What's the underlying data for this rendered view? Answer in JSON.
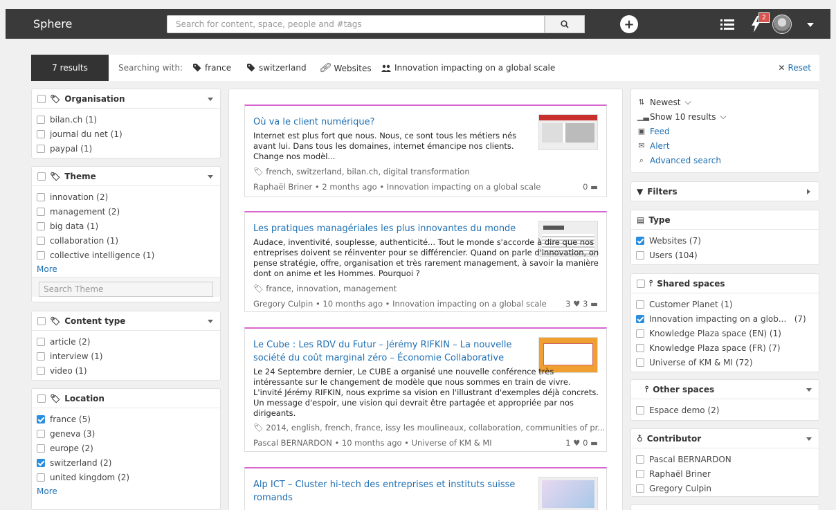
{
  "topbar": {
    "brand": "Sphere",
    "search_placeholder": "Search for content, space, people and #tags",
    "notification_count": "2"
  },
  "results_bar": {
    "count_label": "7 results",
    "searching_label": "Searching with:",
    "tags": [
      {
        "label": "france",
        "icon": "tag-icon"
      },
      {
        "label": "switzerland",
        "icon": "tag-icon"
      },
      {
        "label": "Websites",
        "icon": "link-icon"
      },
      {
        "label": "Innovation impacting on a global scale",
        "icon": "group-icon"
      }
    ],
    "reset_label": "Reset"
  },
  "left_facets": {
    "organisation": {
      "title": "Organisation",
      "items": [
        {
          "label": "bilan.ch (1)",
          "checked": false
        },
        {
          "label": "journal du net (1)",
          "checked": false
        },
        {
          "label": "paypal (1)",
          "checked": false
        }
      ]
    },
    "theme": {
      "title": "Theme",
      "items": [
        {
          "label": "innovation (2)",
          "checked": false
        },
        {
          "label": "management (2)",
          "checked": false
        },
        {
          "label": "big data (1)",
          "checked": false
        },
        {
          "label": "collaboration (1)",
          "checked": false
        },
        {
          "label": "collective intelligence (1)",
          "checked": false
        }
      ],
      "more": "More",
      "search_placeholder": "Search Theme"
    },
    "content_type": {
      "title": "Content type",
      "items": [
        {
          "label": "article (2)",
          "checked": false
        },
        {
          "label": "interview (1)",
          "checked": false
        },
        {
          "label": "video (1)",
          "checked": false
        }
      ]
    },
    "location": {
      "title": "Location",
      "items": [
        {
          "label": "france (5)",
          "checked": true
        },
        {
          "label": "geneva (3)",
          "checked": false
        },
        {
          "label": "europe (2)",
          "checked": false
        },
        {
          "label": "switzerland (2)",
          "checked": true
        },
        {
          "label": "united kingdom (2)",
          "checked": false
        }
      ],
      "more": "More"
    }
  },
  "results": [
    {
      "title": "Où va le client numérique?",
      "description": "Internet est plus fort que nous. Nous, ce sont tous les métiers nés avant lui. Dans tous les domaines, internet émancipe nos clients. Change nos modèl...",
      "tags": "french, switzerland, bilan.ch, digital transformation",
      "meta": "Raphaël Briner • 2 months ago • Innovation impacting on a global scale",
      "counts": "0"
    },
    {
      "title": "Les pratiques managériales les plus innovantes du monde",
      "description": "Audace, inventivité, souplesse, authenticité... Tout le monde s'accorde à dire que nos entreprises doivent se réinventer pour se différencier. Quand on parle d'innovation, on pense stratégie, offre, organisation et très rarement management, à savoir la manière dont on anime et les Hommes. Pourquoi ?",
      "tags": "france, innovation, management",
      "meta": "Gregory Culpin • 10 months ago • Innovation impacting on a global scale",
      "counts": "3 ♥ 3"
    },
    {
      "title": "Le Cube : Les RDV du Futur – Jérémy RIFKIN – La nouvelle société du coût marginal zéro – Économie Collaborative",
      "description": "Le 24 Septembre dernier, Le CUBE a organisé une nouvelle conférence très intéressante sur le changement de modèle que nous sommes en train de vivre. L'invité Jérémy RIFKIN, nous exprime sa vision en l'illustrant d'exemples déjà concrets. Un message d'espoir, une vision qui devrait être partagée et appropriée par nos dirigeants.",
      "tags": "2014, english, french, france, issy les moulineaux, collaboration, communities of pr...",
      "meta": "Pascal BERNARDON • 10 months ago • Universe of KM & MI",
      "counts": "1 ♥ 0"
    },
    {
      "title": "Alp ICT – Cluster hi-tech des entreprises et instituts suisse romands",
      "description": "",
      "tags": "",
      "meta": "",
      "counts": ""
    }
  ],
  "right_panel": {
    "sort_label": "Newest",
    "show_label": "Show 10 results",
    "feed_label": "Feed",
    "alert_label": "Alert",
    "advanced_label": "Advanced search",
    "filters_title": "Filters",
    "type": {
      "title": "Type",
      "items": [
        {
          "label": "Websites (7)",
          "checked": true
        },
        {
          "label": "Users (104)",
          "checked": false
        }
      ]
    },
    "shared_spaces": {
      "title": "Shared spaces",
      "items": [
        {
          "label": "Customer Planet (1)",
          "checked": false
        },
        {
          "label": "Innovation impacting on a glob...   (7)",
          "checked": true
        },
        {
          "label": "Knowledge Plaza space (EN) (1)",
          "checked": false
        },
        {
          "label": "Knowledge Plaza space (FR) (7)",
          "checked": false
        },
        {
          "label": "Universe of KM & MI (72)",
          "checked": false
        }
      ]
    },
    "other_spaces": {
      "title": "Other spaces",
      "items": [
        {
          "label": "Espace demo (2)",
          "checked": false
        }
      ]
    },
    "contributor": {
      "title": "Contributor",
      "items": [
        {
          "label": "Pascal BERNARDON",
          "checked": false
        },
        {
          "label": "Raphaël Briner",
          "checked": false
        },
        {
          "label": "Gregory Culpin",
          "checked": false
        }
      ]
    }
  }
}
